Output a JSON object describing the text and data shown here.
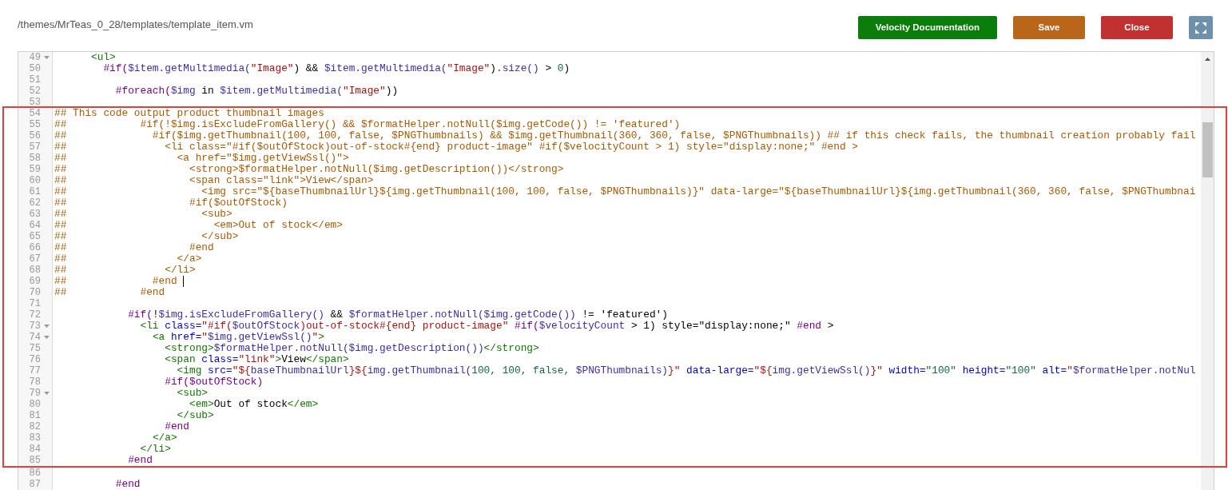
{
  "header": {
    "file_path": "/themes/MrTeas_0_28/templates/template_item.vm",
    "buttons": [
      {
        "label": "Velocity Documentation",
        "kind": "help"
      },
      {
        "label": "Save",
        "kind": "save"
      },
      {
        "label": "Close",
        "kind": "close"
      }
    ]
  },
  "editor": {
    "blocks": [
      {
        "boxed": false,
        "lines": [
          {
            "number": "49",
            "foldable": true,
            "cursor": false,
            "tokens": [
              {
                "kind": "tag",
                "text": "      <ul>"
              }
            ]
          },
          {
            "number": "50",
            "foldable": false,
            "cursor": false,
            "tokens": [
              {
                "kind": "dir",
                "text": "        #if("
              },
              {
                "kind": "var",
                "text": "$item.getMultimedia("
              },
              {
                "kind": "str",
                "text": "\"Image\""
              },
              {
                "kind": "plain",
                "text": ") && "
              },
              {
                "kind": "var",
                "text": "$item.getMultimedia("
              },
              {
                "kind": "str",
                "text": "\"Image\""
              },
              {
                "kind": "plain",
                "text": ")"
              },
              {
                "kind": "var",
                "text": ".size()"
              },
              {
                "kind": "plain",
                "text": " > "
              },
              {
                "kind": "num",
                "text": "0"
              },
              {
                "kind": "plain",
                "text": ")"
              }
            ]
          },
          {
            "number": "51",
            "foldable": false,
            "cursor": false
          },
          {
            "number": "52",
            "foldable": false,
            "cursor": false,
            "tokens": [
              {
                "kind": "dir",
                "text": "          #foreach("
              },
              {
                "kind": "var",
                "text": "$img"
              },
              {
                "kind": "plain",
                "text": " in "
              },
              {
                "kind": "var",
                "text": "$item.getMultimedia("
              },
              {
                "kind": "str",
                "text": "\"Image\""
              },
              {
                "kind": "plain",
                "text": "))"
              }
            ]
          },
          {
            "number": "53",
            "foldable": false,
            "cursor": false
          }
        ]
      },
      {
        "boxed": true,
        "lines": [
          {
            "number": "54",
            "foldable": false,
            "cursor": false,
            "tokens": [
              {
                "kind": "comment",
                "text": "## This code output product thumbnail images"
              }
            ]
          },
          {
            "number": "55",
            "foldable": false,
            "cursor": false,
            "tokens": [
              {
                "kind": "comment",
                "text": "##            #if(!$img.isExcludeFromGallery() && $formatHelper.notNull($img.getCode()) != 'featured')"
              }
            ]
          },
          {
            "number": "56",
            "foldable": false,
            "cursor": false,
            "tokens": [
              {
                "kind": "comment",
                "text": "##              #if($img.getThumbnail(100, 100, false, $PNGThumbnails) && $img.getThumbnail(360, 360, false, $PNGThumbnails)) ## if this check fails, the thumbnail creation probably fail"
              }
            ]
          },
          {
            "number": "57",
            "foldable": false,
            "cursor": false,
            "tokens": [
              {
                "kind": "comment",
                "text": "##                <li class=\"#if($outOfStock)out-of-stock#{end} product-image\" #if($velocityCount > 1) style=\"display:none;\" #end >"
              }
            ]
          },
          {
            "number": "58",
            "foldable": false,
            "cursor": false,
            "tokens": [
              {
                "kind": "comment",
                "text": "##                  <a href=\"$img.getViewSsl()\">"
              }
            ]
          },
          {
            "number": "59",
            "foldable": false,
            "cursor": false,
            "tokens": [
              {
                "kind": "comment",
                "text": "##                    <strong>$formatHelper.notNull($img.getDescription())</strong>"
              }
            ]
          },
          {
            "number": "60",
            "foldable": false,
            "cursor": false,
            "tokens": [
              {
                "kind": "comment",
                "text": "##                    <span class=\"link\">View</span>"
              }
            ]
          },
          {
            "number": "61",
            "foldable": false,
            "cursor": false,
            "tokens": [
              {
                "kind": "comment",
                "text": "##                      <img src=\"${baseThumbnailUrl}${img.getThumbnail(100, 100, false, $PNGThumbnails)}\" data-large=\"${baseThumbnailUrl}${img.getThumbnail(360, 360, false, $PNGThumbnai"
              }
            ]
          },
          {
            "number": "62",
            "foldable": false,
            "cursor": false,
            "tokens": [
              {
                "kind": "comment",
                "text": "##                    #if($outOfStock)"
              }
            ]
          },
          {
            "number": "63",
            "foldable": false,
            "cursor": false,
            "tokens": [
              {
                "kind": "comment",
                "text": "##                      <sub>"
              }
            ]
          },
          {
            "number": "64",
            "foldable": false,
            "cursor": false,
            "tokens": [
              {
                "kind": "comment",
                "text": "##                        <em>Out of stock</em>"
              }
            ]
          },
          {
            "number": "65",
            "foldable": false,
            "cursor": false,
            "tokens": [
              {
                "kind": "comment",
                "text": "##                      </sub>"
              }
            ]
          },
          {
            "number": "66",
            "foldable": false,
            "cursor": false,
            "tokens": [
              {
                "kind": "comment",
                "text": "##                    #end"
              }
            ]
          },
          {
            "number": "67",
            "foldable": false,
            "cursor": false,
            "tokens": [
              {
                "kind": "comment",
                "text": "##                  </a>"
              }
            ]
          },
          {
            "number": "68",
            "foldable": false,
            "cursor": false,
            "tokens": [
              {
                "kind": "comment",
                "text": "##                </li>"
              }
            ]
          },
          {
            "number": "69",
            "foldable": false,
            "cursor": true,
            "tokens": [
              {
                "kind": "comment",
                "text": "##              #end "
              }
            ]
          },
          {
            "number": "70",
            "foldable": false,
            "cursor": false,
            "tokens": [
              {
                "kind": "comment",
                "text": "##            #end"
              }
            ]
          },
          {
            "number": "71",
            "foldable": false,
            "cursor": false
          },
          {
            "number": "72",
            "foldable": false,
            "cursor": false,
            "tokens": [
              {
                "kind": "dir",
                "text": "            #if("
              },
              {
                "kind": "plain",
                "text": "!"
              },
              {
                "kind": "var",
                "text": "$img.isExcludeFromGallery()"
              },
              {
                "kind": "plain",
                "text": " && "
              },
              {
                "kind": "var",
                "text": "$formatHelper.notNull($img.getCode())"
              },
              {
                "kind": "plain",
                "text": " != 'featured')"
              }
            ]
          },
          {
            "number": "73",
            "foldable": true,
            "cursor": false,
            "tokens": [
              {
                "kind": "tag",
                "text": "              <li"
              },
              {
                "kind": "attr",
                "text": " class="
              },
              {
                "kind": "str",
                "text": "\"#if("
              },
              {
                "kind": "var",
                "text": "$outOfStock"
              },
              {
                "kind": "str",
                "text": ")out-of-stock#{end} product-image\""
              },
              {
                "kind": "dir",
                "text": " #if("
              },
              {
                "kind": "var",
                "text": "$velocityCount"
              },
              {
                "kind": "plain",
                "text": " > 1) style=\"display:none;\" "
              },
              {
                "kind": "dir",
                "text": "#end"
              },
              {
                "kind": "plain",
                "text": " >"
              }
            ]
          },
          {
            "number": "74",
            "foldable": true,
            "cursor": false,
            "tokens": [
              {
                "kind": "tag",
                "text": "                <a"
              },
              {
                "kind": "attr",
                "text": " href="
              },
              {
                "kind": "str",
                "text": "\""
              },
              {
                "kind": "var",
                "text": "$img.getViewSsl()"
              },
              {
                "kind": "str",
                "text": "\""
              },
              {
                "kind": "tag",
                "text": ">"
              }
            ]
          },
          {
            "number": "75",
            "foldable": false,
            "cursor": false,
            "tokens": [
              {
                "kind": "tag",
                "text": "                  <strong>"
              },
              {
                "kind": "var",
                "text": "$formatHelper.notNull($img.getDescription())"
              },
              {
                "kind": "tag",
                "text": "</strong>"
              }
            ]
          },
          {
            "number": "76",
            "foldable": false,
            "cursor": false,
            "tokens": [
              {
                "kind": "tag",
                "text": "                  <span"
              },
              {
                "kind": "attr",
                "text": " class="
              },
              {
                "kind": "str",
                "text": "\"link\""
              },
              {
                "kind": "tag",
                "text": ">"
              },
              {
                "kind": "plain",
                "text": "View"
              },
              {
                "kind": "tag",
                "text": "</span>"
              }
            ]
          },
          {
            "number": "77",
            "foldable": false,
            "cursor": false,
            "tokens": [
              {
                "kind": "tag",
                "text": "                    <img"
              },
              {
                "kind": "attr",
                "text": " src="
              },
              {
                "kind": "str",
                "text": "\"${"
              },
              {
                "kind": "var",
                "text": "baseThumbnailUrl"
              },
              {
                "kind": "str",
                "text": "}${"
              },
              {
                "kind": "var",
                "text": "img.getThumbnail("
              },
              {
                "kind": "num",
                "text": "100, 100, false, "
              },
              {
                "kind": "var",
                "text": "$PNGThumbnails)"
              },
              {
                "kind": "str",
                "text": "}\""
              },
              {
                "kind": "attr",
                "text": " data-large="
              },
              {
                "kind": "str",
                "text": "\"${"
              },
              {
                "kind": "var",
                "text": "img.getViewSsl()"
              },
              {
                "kind": "str",
                "text": "}\""
              },
              {
                "kind": "attr",
                "text": " width="
              },
              {
                "kind": "num",
                "text": "\"100\""
              },
              {
                "kind": "attr",
                "text": " height="
              },
              {
                "kind": "num",
                "text": "\"100\""
              },
              {
                "kind": "attr",
                "text": " alt="
              },
              {
                "kind": "str",
                "text": "\""
              },
              {
                "kind": "var",
                "text": "$formatHelper.notNul"
              }
            ]
          },
          {
            "number": "78",
            "foldable": false,
            "cursor": false,
            "tokens": [
              {
                "kind": "dir",
                "text": "                  #if($outOfStock)"
              }
            ]
          },
          {
            "number": "79",
            "foldable": true,
            "cursor": false,
            "tokens": [
              {
                "kind": "tag",
                "text": "                    <sub>"
              }
            ]
          },
          {
            "number": "80",
            "foldable": false,
            "cursor": false,
            "tokens": [
              {
                "kind": "tag",
                "text": "                      <em>"
              },
              {
                "kind": "plain",
                "text": "Out of stock"
              },
              {
                "kind": "tag",
                "text": "</em>"
              }
            ]
          },
          {
            "number": "81",
            "foldable": false,
            "cursor": false,
            "tokens": [
              {
                "kind": "tag",
                "text": "                    </sub>"
              }
            ]
          },
          {
            "number": "82",
            "foldable": false,
            "cursor": false,
            "tokens": [
              {
                "kind": "dir",
                "text": "                  #end"
              }
            ]
          },
          {
            "number": "83",
            "foldable": false,
            "cursor": false,
            "tokens": [
              {
                "kind": "tag",
                "text": "                </a>"
              }
            ]
          },
          {
            "number": "84",
            "foldable": false,
            "cursor": false,
            "tokens": [
              {
                "kind": "tag",
                "text": "              </li>"
              }
            ]
          },
          {
            "number": "85",
            "foldable": false,
            "cursor": false,
            "tokens": [
              {
                "kind": "dir",
                "text": "            #end"
              }
            ]
          }
        ]
      },
      {
        "boxed": false,
        "lines": [
          {
            "number": "86",
            "foldable": false,
            "cursor": false
          },
          {
            "number": "87",
            "foldable": false,
            "cursor": false,
            "tokens": [
              {
                "kind": "dir",
                "text": "          #end"
              }
            ]
          }
        ]
      }
    ]
  }
}
